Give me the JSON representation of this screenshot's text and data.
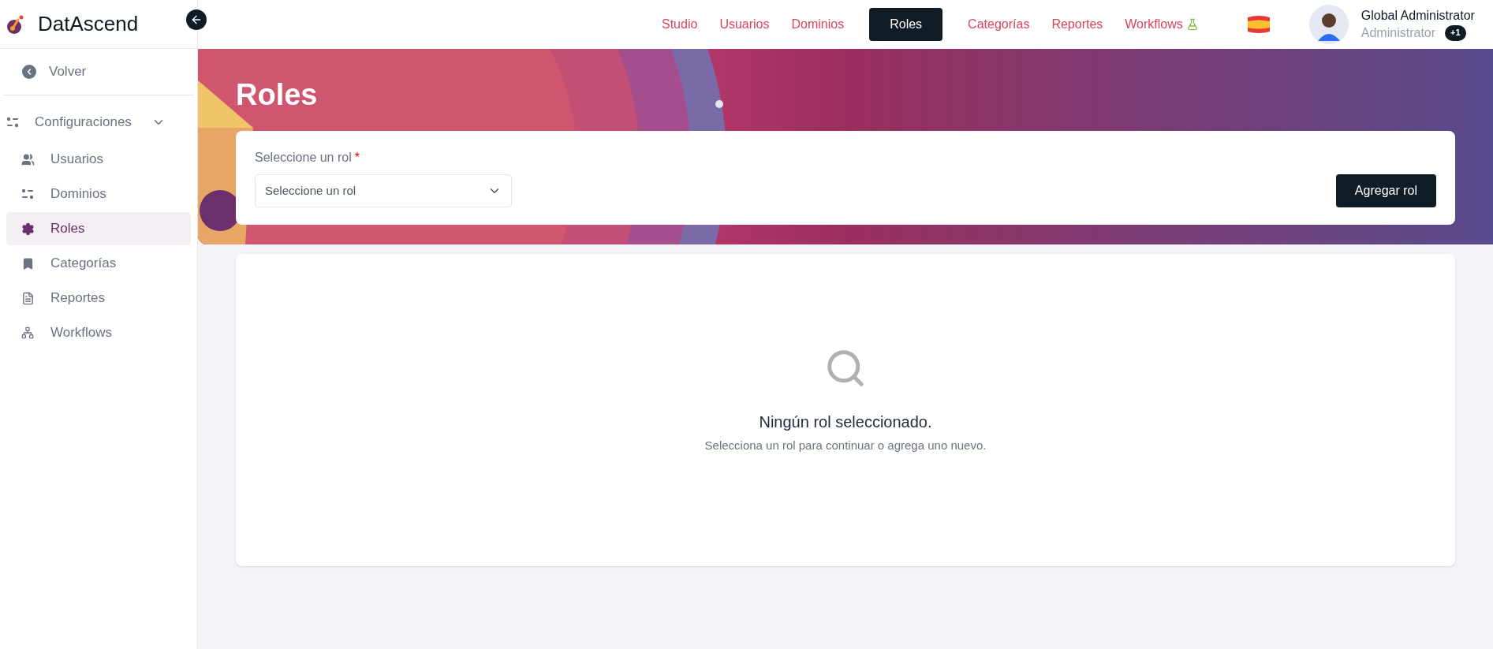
{
  "brand": {
    "name": "DatAscend"
  },
  "sidebar": {
    "back": "Volver",
    "group": {
      "label": "Configuraciones",
      "expanded": true,
      "items": [
        {
          "label": "Usuarios",
          "selected": false
        },
        {
          "label": "Dominios",
          "selected": false
        },
        {
          "label": "Roles",
          "selected": true
        },
        {
          "label": "Categorías",
          "selected": false
        },
        {
          "label": "Reportes",
          "selected": false
        },
        {
          "label": "Workflows",
          "selected": false
        }
      ]
    }
  },
  "nav": [
    {
      "label": "Studio",
      "selected": false
    },
    {
      "label": "Usuarios",
      "selected": false
    },
    {
      "label": "Dominios",
      "selected": false
    },
    {
      "label": "Roles",
      "selected": true
    },
    {
      "label": "Categorías",
      "selected": false
    },
    {
      "label": "Reportes",
      "selected": false
    },
    {
      "label": "Workflows",
      "selected": false
    }
  ],
  "user": {
    "name": "Global Administrator",
    "role": "Administrator",
    "extra_roles": "+1"
  },
  "page": {
    "title": "Roles",
    "field": {
      "label": "Seleccione un rol",
      "required_mark": "*",
      "placeholder": "Seleccione un rol"
    },
    "add_button": "Agregar rol"
  },
  "empty_state": {
    "title": "Ningún rol seleccionado.",
    "message": "Selecciona un rol para continuar o agrega uno nuevo."
  }
}
